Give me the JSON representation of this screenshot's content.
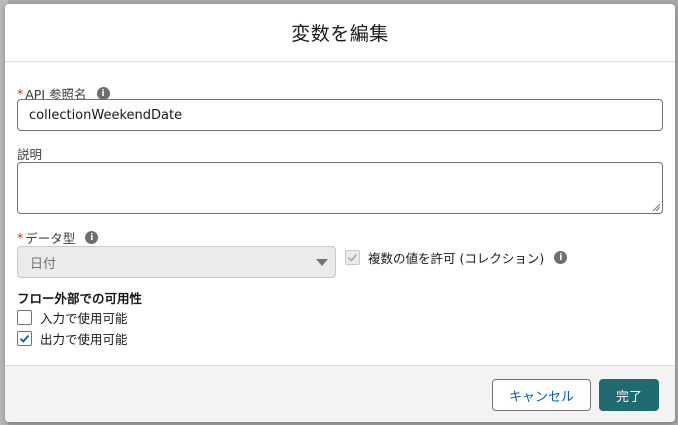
{
  "modal": {
    "title": "変数を編集"
  },
  "api_name": {
    "required_mark": "*",
    "label": "API 参照名",
    "value": "collectionWeekendDate"
  },
  "description": {
    "label": "説明",
    "value": ""
  },
  "data_type": {
    "required_mark": "*",
    "label": "データ型",
    "selected": "日付"
  },
  "allow_multiple": {
    "label": "複数の値を許可 (コレクション)",
    "checked": true,
    "disabled": true
  },
  "availability": {
    "title": "フロー外部での可用性",
    "input_label": "入力で使用可能",
    "input_checked": false,
    "output_label": "出力で使用可能",
    "output_checked": true
  },
  "footer": {
    "cancel_label": "キャンセル",
    "done_label": "完了"
  },
  "colors": {
    "primary": "#1f6b71",
    "link": "#0b5cab",
    "required": "#c23934"
  },
  "icons": {
    "info": "info-icon",
    "dropdown": "chevron-down-icon",
    "check": "check-icon"
  }
}
